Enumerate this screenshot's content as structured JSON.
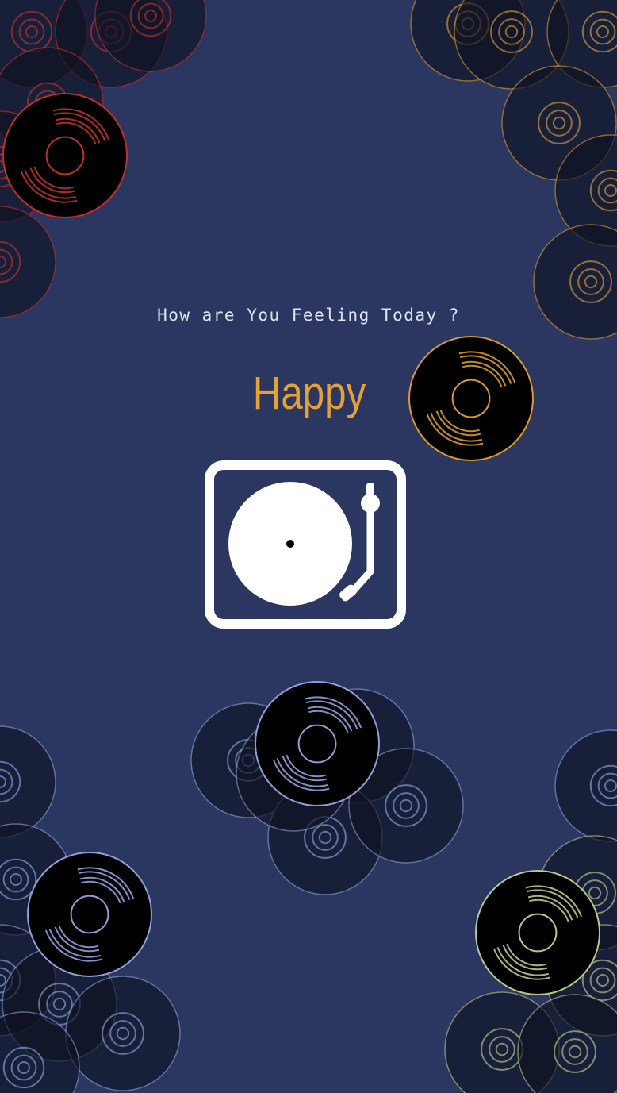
{
  "prompt": {
    "question": "How are You Feeling Today ?"
  },
  "mood": {
    "label": "Happy",
    "color": "#e3a232"
  },
  "colors": {
    "background": "#2b3761",
    "record_fill": "#0f1222",
    "record_dark": "#000000",
    "red_accent": "#c0302a",
    "orange_accent": "#d89a30",
    "blue_accent": "#8fa0d8",
    "green_accent": "#b9c98a",
    "white": "#ffffff"
  },
  "icons": {
    "turntable": "turntable-icon",
    "records": "vinyl-record-icon"
  }
}
